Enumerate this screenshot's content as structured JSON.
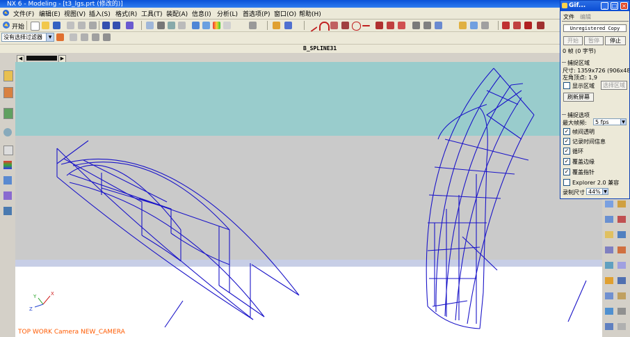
{
  "window": {
    "title": "NX 6 - Modeling - [t3_lgs.prt (修改的)]"
  },
  "menu": {
    "start_label": "开始",
    "items": [
      "文件(F)",
      "编辑(E)",
      "视图(V)",
      "插入(S)",
      "格式(R)",
      "工具(T)",
      "装配(A)",
      "信息(I)",
      "分析(L)",
      "首选项(P)",
      "窗口(O)",
      "帮助(H)"
    ]
  },
  "selection_bar": {
    "filter": "没有选择过滤器"
  },
  "part_name": "B_SPLINE31",
  "viewport": {
    "camera_label": "TOP WORK Camera NEW_CAMERA",
    "axis_labels": {
      "x": "X",
      "y": "Y",
      "z": "Z"
    }
  },
  "colors": {
    "sky": "#99cccc",
    "ground": "#cacaca",
    "wireframe": "#1a14c8",
    "camera_label": "#ff5a00",
    "title_bar": "#0a52d8"
  },
  "gif_window": {
    "title": "Gif...",
    "menu": [
      "文件",
      "编辑"
    ],
    "unregistered": "Unregistered Copy",
    "buttons": {
      "start": "开始",
      "pause": "暂停",
      "stop": "停止"
    },
    "frames": "0 帧 (0 字节)",
    "capture_area_header": "捕捉区域",
    "size_label": "尺寸: 1359x726 (906x484)",
    "corner_label": "左角顶点: 1,9",
    "show_area": "显示区域",
    "select_area": "选择区域",
    "refresh": "刷新屏幕",
    "capture_options_header": "捕捉选项",
    "max_fps_label": "最大帧频:",
    "max_fps_value": "5 fps",
    "options": [
      {
        "label": "帧间透明",
        "checked": true
      },
      {
        "label": "记录时间信息",
        "checked": true
      },
      {
        "label": "循环",
        "checked": true
      },
      {
        "label": "覆盖边缘",
        "checked": true
      },
      {
        "label": "覆盖指针",
        "checked": true
      },
      {
        "label": "Explorer 2.0 兼容",
        "checked": false
      }
    ],
    "record_size_label": "录制尺寸",
    "record_size_value": "44%"
  }
}
